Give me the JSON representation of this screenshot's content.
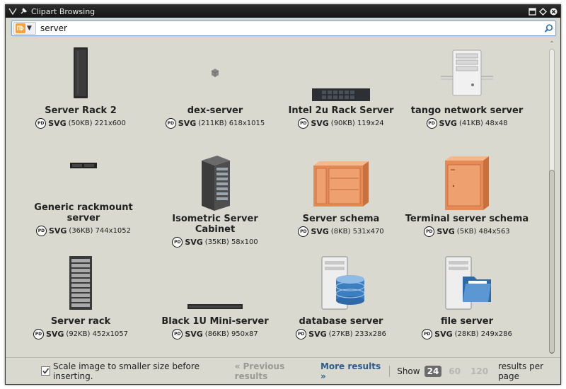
{
  "window": {
    "title": "Clipart Browsing"
  },
  "search": {
    "value": "server",
    "engine_icon": "openclipart-icon"
  },
  "results": [
    {
      "name": "Server Rack 2",
      "license": "PD",
      "format": "SVG",
      "size": "(50KB)",
      "dimensions": "221x600"
    },
    {
      "name": "dex-server",
      "license": "PD",
      "format": "SVG",
      "size": "(211KB)",
      "dimensions": "618x1015"
    },
    {
      "name": "Intel 2u Rack Server",
      "license": "PD",
      "format": "SVG",
      "size": "(90KB)",
      "dimensions": "119x24"
    },
    {
      "name": "tango network server",
      "license": "PD",
      "format": "SVG",
      "size": "(41KB)",
      "dimensions": "48x48"
    },
    {
      "name": "Generic rackmount server",
      "license": "PD",
      "format": "SVG",
      "size": "(36KB)",
      "dimensions": "744x1052"
    },
    {
      "name": "Isometric Server Cabinet",
      "license": "PD",
      "format": "SVG",
      "size": "(35KB)",
      "dimensions": "58x100"
    },
    {
      "name": "Server schema",
      "license": "PD",
      "format": "SVG",
      "size": "(8KB)",
      "dimensions": "531x470"
    },
    {
      "name": "Terminal server schema",
      "license": "PD",
      "format": "SVG",
      "size": "(5KB)",
      "dimensions": "484x563"
    },
    {
      "name": "Server rack",
      "license": "PD",
      "format": "SVG",
      "size": "(92KB)",
      "dimensions": "452x1057"
    },
    {
      "name": "Black 1U Mini-server",
      "license": "PD",
      "format": "SVG",
      "size": "(86KB)",
      "dimensions": "950x87"
    },
    {
      "name": "database server",
      "license": "PD",
      "format": "SVG",
      "size": "(27KB)",
      "dimensions": "233x286"
    },
    {
      "name": "file server",
      "license": "PD",
      "format": "SVG",
      "size": "(28KB)",
      "dimensions": "249x286"
    }
  ],
  "footer": {
    "scale_label": "Scale image to smaller size before inserting.",
    "scale_checked": true,
    "previous_label": "« Previous results",
    "more_label": "More results »",
    "show_label": "Show",
    "per_page_options": [
      "24",
      "60",
      "120"
    ],
    "per_page_selected": "24",
    "per_page_suffix": "results per page"
  },
  "colors": {
    "accent_link": "#2e5b8a",
    "disabled": "#9a9a94",
    "background": "#d9d9d0"
  }
}
